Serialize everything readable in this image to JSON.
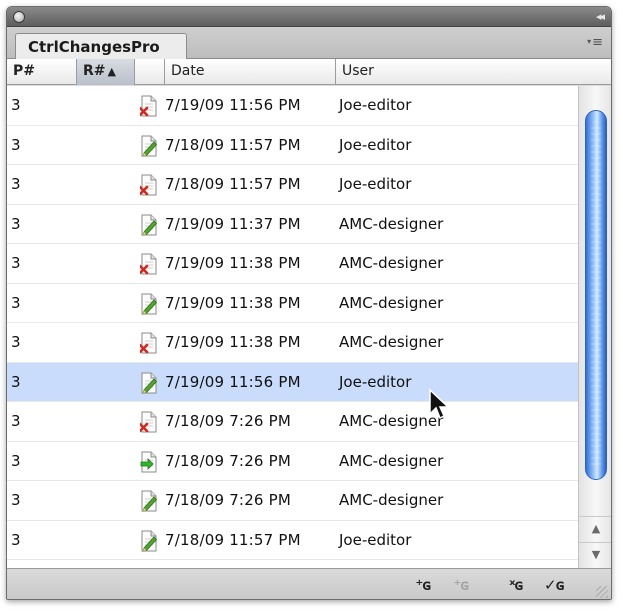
{
  "panel": {
    "tab_label": "CtrlChangesPro",
    "collapse_glyph": "◂◂",
    "menu_glyph": "≡",
    "menu_caret": "▾"
  },
  "table": {
    "columns": [
      "P#",
      "R#",
      "",
      "Date",
      "User"
    ],
    "sort_indicator": "▲",
    "rows": [
      {
        "p": "3",
        "icon": "deleted-doc-icon",
        "date": "7/19/09 11:56 PM",
        "user": "Joe-editor",
        "selected": false
      },
      {
        "p": "3",
        "icon": "edited-doc-icon",
        "date": "7/18/09 11:57 PM",
        "user": "Joe-editor",
        "selected": false
      },
      {
        "p": "3",
        "icon": "deleted-doc-icon",
        "date": "7/18/09 11:57 PM",
        "user": "Joe-editor",
        "selected": false
      },
      {
        "p": "3",
        "icon": "edited-doc-icon",
        "date": "7/19/09 11:37 PM",
        "user": "AMC-designer",
        "selected": false
      },
      {
        "p": "3",
        "icon": "deleted-doc-icon",
        "date": "7/19/09 11:38 PM",
        "user": "AMC-designer",
        "selected": false
      },
      {
        "p": "3",
        "icon": "edited-doc-icon",
        "date": "7/19/09 11:38 PM",
        "user": "AMC-designer",
        "selected": false
      },
      {
        "p": "3",
        "icon": "deleted-doc-icon",
        "date": "7/19/09 11:38 PM",
        "user": "AMC-designer",
        "selected": false
      },
      {
        "p": "3",
        "icon": "edited-doc-icon",
        "date": "7/19/09 11:56 PM",
        "user": "Joe-editor",
        "selected": true
      },
      {
        "p": "3",
        "icon": "deleted-doc-icon",
        "date": "7/18/09 7:26 PM",
        "user": "AMC-designer",
        "selected": false
      },
      {
        "p": "3",
        "icon": "moved-doc-icon",
        "date": "7/18/09 7:26 PM",
        "user": "AMC-designer",
        "selected": false
      },
      {
        "p": "3",
        "icon": "edited-doc-icon",
        "date": "7/18/09 7:26 PM",
        "user": "AMC-designer",
        "selected": false
      },
      {
        "p": "3",
        "icon": "edited-doc-icon",
        "date": "7/18/09 11:57 PM",
        "user": "Joe-editor",
        "selected": false
      }
    ]
  },
  "scrollbar": {
    "up_glyph": "▲",
    "down_glyph": "▼"
  },
  "footer": {
    "buttons": [
      {
        "name": "accept-change-button",
        "glyph": "⁺ɢ",
        "disabled": false
      },
      {
        "name": "accept-all-button",
        "glyph": "⁺ɢ",
        "disabled": true
      },
      {
        "name": "reject-change-button",
        "glyph": "ˣɢ",
        "disabled": false
      },
      {
        "name": "approve-change-button",
        "glyph": "✓ɢ",
        "disabled": false
      }
    ]
  },
  "colors": {
    "selection": "#c9dcfb",
    "scroll_thumb": "#4f8ef0",
    "delete_mark": "#d4281c",
    "edit_pencil": "#4fa82a",
    "move_arrow": "#2fb52a"
  }
}
